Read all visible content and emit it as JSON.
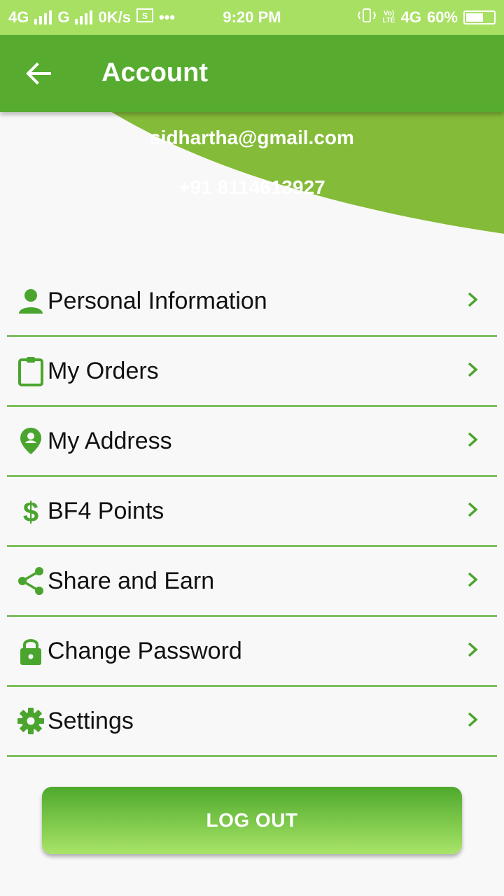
{
  "status_bar": {
    "network_1": "4G",
    "network_2": "G",
    "speed": "0K/s",
    "time": "9:20 PM",
    "network_3": "4G",
    "battery": "60%",
    "battery_level": 0.6
  },
  "app_bar": {
    "title": "Account"
  },
  "profile": {
    "email": "sidhartha@gmail.com",
    "phone": "+91 8114613927"
  },
  "menu": {
    "items": [
      {
        "label": "Personal Information",
        "icon": "person-icon"
      },
      {
        "label": "My Orders",
        "icon": "clipboard-icon"
      },
      {
        "label": "My Address",
        "icon": "location-pin-icon"
      },
      {
        "label": "BF4 Points",
        "icon": "dollar-icon"
      },
      {
        "label": "Share and Earn",
        "icon": "share-icon"
      },
      {
        "label": "Change Password",
        "icon": "lock-icon"
      },
      {
        "label": "Settings",
        "icon": "gear-icon"
      }
    ]
  },
  "logout": {
    "label": "LOG OUT"
  },
  "colors": {
    "status_bar": "#a8e063",
    "app_bar": "#57ab2f",
    "header_curve": "#84bb38",
    "accent": "#5aae34",
    "background": "#f8f8f8"
  }
}
